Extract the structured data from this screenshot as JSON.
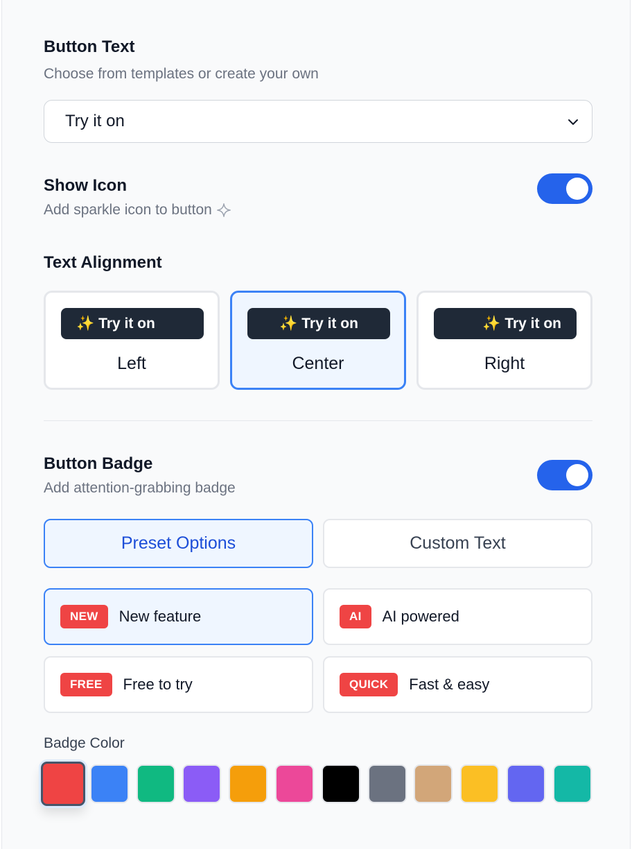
{
  "button_text": {
    "title": "Button Text",
    "description": "Choose from templates or create your own",
    "selected": "Try it on"
  },
  "show_icon": {
    "title": "Show Icon",
    "description": "Add sparkle icon to button",
    "enabled": true
  },
  "text_alignment": {
    "title": "Text Alignment",
    "options": [
      {
        "preview": "Try it on",
        "label": "Left",
        "selected": false
      },
      {
        "preview": "Try it on",
        "label": "Center",
        "selected": true
      },
      {
        "preview": "Try it on",
        "label": "Right",
        "selected": false
      }
    ]
  },
  "button_badge": {
    "title": "Button Badge",
    "description": "Add attention-grabbing badge",
    "enabled": true,
    "tabs": [
      {
        "label": "Preset Options",
        "active": true
      },
      {
        "label": "Custom Text",
        "active": false
      }
    ],
    "presets": [
      {
        "badge": "NEW",
        "label": "New feature",
        "selected": true
      },
      {
        "badge": "AI",
        "label": "AI powered",
        "selected": false
      },
      {
        "badge": "FREE",
        "label": "Free to try",
        "selected": false
      },
      {
        "badge": "QUICK",
        "label": "Fast & easy",
        "selected": false
      }
    ]
  },
  "badge_color": {
    "label": "Badge Color",
    "selected": "#ef4444",
    "swatches": [
      "#ef4444",
      "#3b82f6",
      "#10b981",
      "#8b5cf6",
      "#f59e0b",
      "#ec4899",
      "#000000",
      "#6b7280",
      "#d2a679",
      "#fbbf24",
      "#6366f1",
      "#14b8a6"
    ]
  },
  "icons": {
    "select_caret": "chevron-down-icon",
    "sparkle_outline": "sparkle-icon",
    "sparkle_emoji": "✨"
  }
}
